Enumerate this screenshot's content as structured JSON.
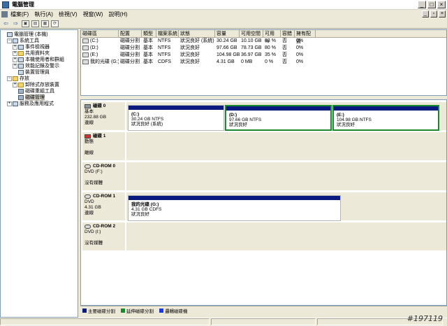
{
  "window": {
    "title": "電腦管理",
    "btn_min": "_",
    "btn_max": "□",
    "btn_close": "×"
  },
  "menu": [
    "檔案(F)",
    "執行(A)",
    "檢視(V)",
    "視窗(W)",
    "說明(H)"
  ],
  "inner_btns": {
    "min": "_",
    "max": "▫",
    "close": "×"
  },
  "toolbar": {
    "back": "⇦",
    "forward": "⇨",
    "up": "▣",
    "view": "▤",
    "props": "▦",
    "refresh": "⟳"
  },
  "tree": [
    {
      "label": "電腦管理 (本機)",
      "indent": 0,
      "exp": "",
      "icon": "computer-icon"
    },
    {
      "label": "系統工具",
      "indent": 1,
      "exp": "−",
      "icon": "tools-icon"
    },
    {
      "label": "事件檢視器",
      "indent": 2,
      "exp": "+",
      "icon": "event-viewer-icon"
    },
    {
      "label": "共用資料夾",
      "indent": 2,
      "exp": "+",
      "icon": "folder-icon"
    },
    {
      "label": "本機使用者和群組",
      "indent": 2,
      "exp": "+",
      "icon": "users-icon"
    },
    {
      "label": "效能記錄及警示",
      "indent": 2,
      "exp": "+",
      "icon": "performance-icon"
    },
    {
      "label": "裝置管理員",
      "indent": 2,
      "exp": "",
      "icon": "device-icon"
    },
    {
      "label": "存放",
      "indent": 1,
      "exp": "−",
      "icon": "storage-icon"
    },
    {
      "label": "卸除式存放裝置",
      "indent": 2,
      "exp": "+",
      "icon": "removable-icon"
    },
    {
      "label": "磁碟重組工具",
      "indent": 2,
      "exp": "",
      "icon": "defrag-icon"
    },
    {
      "label": "磁碟管理",
      "indent": 2,
      "exp": "",
      "icon": "disk-icon",
      "selected": true
    },
    {
      "label": "服務及應用程式",
      "indent": 1,
      "exp": "+",
      "icon": "services-icon"
    }
  ],
  "volume_list": {
    "headers": [
      "磁碟區",
      "配置",
      "類型",
      "檔案系統",
      "狀態",
      "容量",
      "可用空間",
      "可用 %",
      "容錯",
      "擁有配置"
    ],
    "rows": [
      [
        "(C:)",
        "磁碟分割",
        "基本",
        "NTFS",
        "狀況良好 (系統)",
        "30.24 GB",
        "10.10 GB",
        "33 %",
        "否",
        "0%"
      ],
      [
        "(D:)",
        "磁碟分割",
        "基本",
        "NTFS",
        "狀況良好",
        "97.66 GB",
        "78.73 GB",
        "80 %",
        "否",
        "0%"
      ],
      [
        "(E:)",
        "磁碟分割",
        "基本",
        "NTFS",
        "狀況良好",
        "104.98 GB",
        "36.97 GB",
        "35 %",
        "否",
        "0%"
      ],
      [
        "我的光碟 (G:)",
        "磁碟分割",
        "基本",
        "CDFS",
        "狀況良好",
        "4.31 GB",
        "0 MB",
        "0 %",
        "否",
        "0%"
      ]
    ]
  },
  "disks": [
    {
      "name": "磁碟 0",
      "line1": "基本",
      "line2": "232.88 GB",
      "line3": "連線",
      "partitions": [
        {
          "label": "(C:)",
          "fs": "30.24 GB NTFS",
          "status": "狀況良好 (系統)"
        },
        {
          "label": "(D:)",
          "fs": "97.66 GB NTFS",
          "status": "狀況良好"
        },
        {
          "label": "(E:)",
          "fs": "104.98 GB NTFS",
          "status": "狀況良好"
        }
      ]
    },
    {
      "name": "磁碟 1",
      "line1": "動態",
      "line2": "",
      "line3": "離線"
    },
    {
      "name": "CD-ROM 0",
      "line1": "DVD (F:)",
      "line2": "",
      "line3": "沒有媒體"
    },
    {
      "name": "CD-ROM 1",
      "line1": "DVD",
      "line2": "4.31 GB",
      "line3": "連線",
      "partitions": [
        {
          "label": "我的光碟 (G:)",
          "fs": "4.31 GB CDFS",
          "status": "狀況良好"
        }
      ]
    },
    {
      "name": "CD-ROM 2",
      "line1": "DVD (I:)",
      "line2": "",
      "line3": "沒有媒體"
    }
  ],
  "legend": [
    {
      "label": "主要磁碟分割",
      "color": "#0a1a7f"
    },
    {
      "label": "延伸磁碟分割",
      "color": "#1b8a2c"
    },
    {
      "label": "邏輯磁碟機",
      "color": "#1a3adf"
    }
  ],
  "watermark": "#197119"
}
